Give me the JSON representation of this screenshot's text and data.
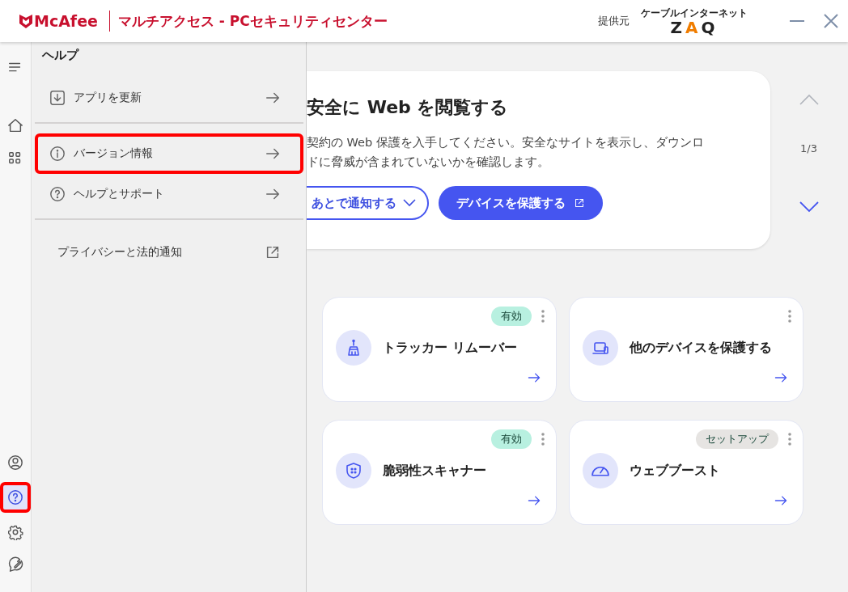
{
  "window": {
    "brand": "McAfee",
    "title": "マルチアクセス - PCセキュリティセンター",
    "provider_label": "提供元",
    "provider_logo_caption": "ケーブルインターネット",
    "provider_logo": "ZAQ"
  },
  "rail": [
    {
      "kind": "menu",
      "selected": false,
      "highlighted": false
    },
    {
      "kind": "home",
      "selected": false,
      "highlighted": false
    },
    {
      "kind": "apps",
      "selected": false,
      "highlighted": false
    },
    {
      "kind": "spacer"
    },
    {
      "kind": "account",
      "selected": false,
      "highlighted": false
    },
    {
      "kind": "help",
      "selected": true,
      "highlighted": true
    },
    {
      "kind": "settings",
      "selected": false,
      "highlighted": false
    },
    {
      "kind": "feedback",
      "selected": false,
      "highlighted": false
    }
  ],
  "help_panel": {
    "title": "ヘルプ",
    "items": [
      {
        "label": "アプリを更新",
        "kind": "update",
        "highlighted": false,
        "divider_after": true
      },
      {
        "label": "バージョン情報",
        "kind": "info",
        "highlighted": true,
        "divider_after": false
      },
      {
        "label": "ヘルプとサポート",
        "kind": "help",
        "highlighted": false,
        "divider_after": true
      },
      {
        "label": "プライバシーと法的通知",
        "kind": "external",
        "highlighted": false,
        "divider_after": false
      }
    ]
  },
  "banner": {
    "title": "安全に Web を閲覧する",
    "lines": [
      "契約の Web 保護を入手してください。安全なサイトを表示し、ダウンロ",
      "ドに脅威が含まれていないかを確認します。"
    ],
    "secondary_button": "あとで通知する",
    "primary_button": "デバイスを保護する",
    "pager": "1/3"
  },
  "tiles": [
    {
      "title": "トラッカー リムーバー",
      "kind": "tracker",
      "status": {
        "label": "有効",
        "color": "#b8f0e0"
      }
    },
    {
      "title": "他のデバイスを保護する",
      "kind": "devices"
    },
    {
      "title": "脆弱性スキャナー",
      "kind": "scanner",
      "status": {
        "label": "有効",
        "color": "#b8f0e0"
      }
    },
    {
      "title": "ウェブブースト",
      "kind": "boost",
      "status": {
        "label": "セットアップ",
        "color": "#e6e4e2"
      }
    }
  ]
}
